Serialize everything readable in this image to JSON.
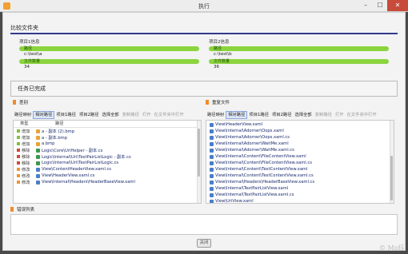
{
  "window": {
    "title": "执行",
    "min": "–",
    "max": "☐",
    "close": "✕"
  },
  "section": {
    "title": "比较文件夹"
  },
  "project1": {
    "label": "项目1信息",
    "path_label": "路径",
    "path_value": "c:\\test\\a",
    "count_label": "文件数量",
    "count_value": "34"
  },
  "project2": {
    "label": "项目2信息",
    "path_label": "路径",
    "path_value": "c:\\test\\b",
    "count_label": "文件数量",
    "count_value": "36"
  },
  "status": {
    "text": "任务已完成"
  },
  "diff_panel": {
    "title": "差别",
    "toolbar": [
      {
        "label": "路径映射",
        "state": "normal"
      },
      {
        "label": "相对路径",
        "state": "selected"
      },
      {
        "label": "项目1路径",
        "state": "normal"
      },
      {
        "label": "项目2路径",
        "state": "normal"
      },
      {
        "label": "选择全部",
        "state": "normal"
      },
      {
        "label": "复制路径",
        "state": "disabled"
      },
      {
        "label": "打开",
        "state": "disabled"
      },
      {
        "label": "在文件夹中打开",
        "state": "disabled"
      }
    ],
    "col_type": "类型",
    "col_path": "路径",
    "rows": [
      {
        "type": "增加",
        "type_color": "#7cc242",
        "icon_color": "#e8a33a",
        "path": "a - 副本 (2).bmp"
      },
      {
        "type": "增加",
        "type_color": "#7cc242",
        "icon_color": "#e8a33a",
        "path": "a - 副本.bmp"
      },
      {
        "type": "增加",
        "type_color": "#7cc242",
        "icon_color": "#e8a33a",
        "path": "a.bmp"
      },
      {
        "type": "移除",
        "type_color": "#d04a3a",
        "icon_color": "#3a9a4a",
        "path": "Logic\\Core\\UriHelper - 副本.cs"
      },
      {
        "type": "移除",
        "type_color": "#d04a3a",
        "icon_color": "#3a9a4a",
        "path": "Logic\\Internal\\Uri\\TextPairListLogic - 副本.cs"
      },
      {
        "type": "移除",
        "type_color": "#d04a3a",
        "icon_color": "#3a9a4a",
        "path": "Logic\\Internal\\Uri\\TextPairListLogic.cs"
      },
      {
        "type": "修改",
        "type_color": "#f0962e",
        "icon_color": "#4a7fc8",
        "path": "View\\ContentHeaderView.xaml.cs"
      },
      {
        "type": "修改",
        "type_color": "#f0962e",
        "icon_color": "#4a7fc8",
        "path": "View\\HeaderView.xaml.cs"
      },
      {
        "type": "修改",
        "type_color": "#f0962e",
        "icon_color": "#4a7fc8",
        "path": "View\\Internal\\Headers\\HeaderBaseView.xaml"
      }
    ]
  },
  "dup_panel": {
    "title": "重复文件",
    "toolbar": [
      {
        "label": "路径映射",
        "state": "normal"
      },
      {
        "label": "相对路径",
        "state": "selected"
      },
      {
        "label": "项目1路径",
        "state": "normal"
      },
      {
        "label": "项目2路径",
        "state": "normal"
      },
      {
        "label": "选择全部",
        "state": "normal"
      },
      {
        "label": "复制路径",
        "state": "disabled"
      },
      {
        "label": "打开",
        "state": "disabled"
      },
      {
        "label": "在文件夹中打开",
        "state": "disabled"
      }
    ],
    "rows": [
      "View\\HeaderView.xaml",
      "View\\Internal\\Adorner\\Oops.xaml",
      "View\\Internal\\Adorner\\Oops.xaml.cs",
      "View\\Internal\\Adorner\\WaitMe.xaml",
      "View\\Internal\\Adorner\\WaitMe.xaml.cs",
      "View\\Internal\\Content\\FileContentView.xaml",
      "View\\Internal\\Content\\FileContentView.xaml.cs",
      "View\\Internal\\Content\\TextContentView.xaml",
      "View\\Internal\\Content\\TextContentView.xaml.cs",
      "View\\Internal\\Headers\\HeaderBaseView.xaml.cs",
      "View\\Internal\\TextPairListView.xaml",
      "View\\Internal\\TextPairListView.xaml.cs",
      "View\\UriView.xaml"
    ]
  },
  "errors": {
    "title": "错误列表"
  },
  "footer": {
    "close_label": "关闭",
    "watermark": "© Mo珏"
  }
}
